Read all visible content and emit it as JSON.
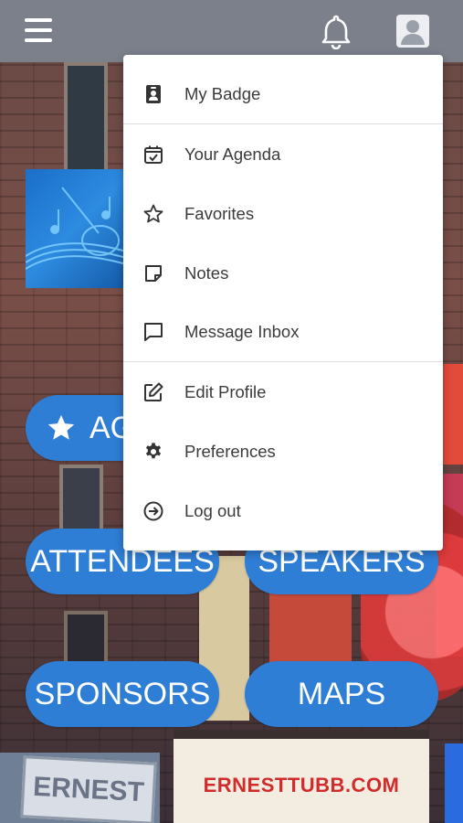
{
  "topbar": {
    "menu_icon": "hamburger-menu-icon",
    "notifications_icon": "bell-icon",
    "account_icon": "user-avatar-icon",
    "background_color": "#7b808b"
  },
  "main_nav": {
    "agenda_label": "AG",
    "attendees_label": "ATTENDEES",
    "speakers_label": "SPEAKERS",
    "sponsors_label": "SPONSORS",
    "maps_label": "MAPS",
    "accent_color": "#2f7ed6"
  },
  "background": {
    "marquee_text": "ERNESTTUBB.COM",
    "sign_text": "ERNEST TUBB"
  },
  "user_menu": {
    "items": [
      {
        "label": "My Badge",
        "icon": "badge-icon"
      },
      {
        "label": "Your Agenda",
        "icon": "calendar-check-icon"
      },
      {
        "label": "Favorites",
        "icon": "star-outline-icon"
      },
      {
        "label": "Notes",
        "icon": "sticky-note-icon"
      },
      {
        "label": "Message Inbox",
        "icon": "chat-bubble-icon"
      },
      {
        "label": "Edit Profile",
        "icon": "edit-pencil-icon"
      },
      {
        "label": "Preferences",
        "icon": "gear-icon"
      },
      {
        "label": "Log out",
        "icon": "logout-arrow-icon"
      }
    ]
  }
}
